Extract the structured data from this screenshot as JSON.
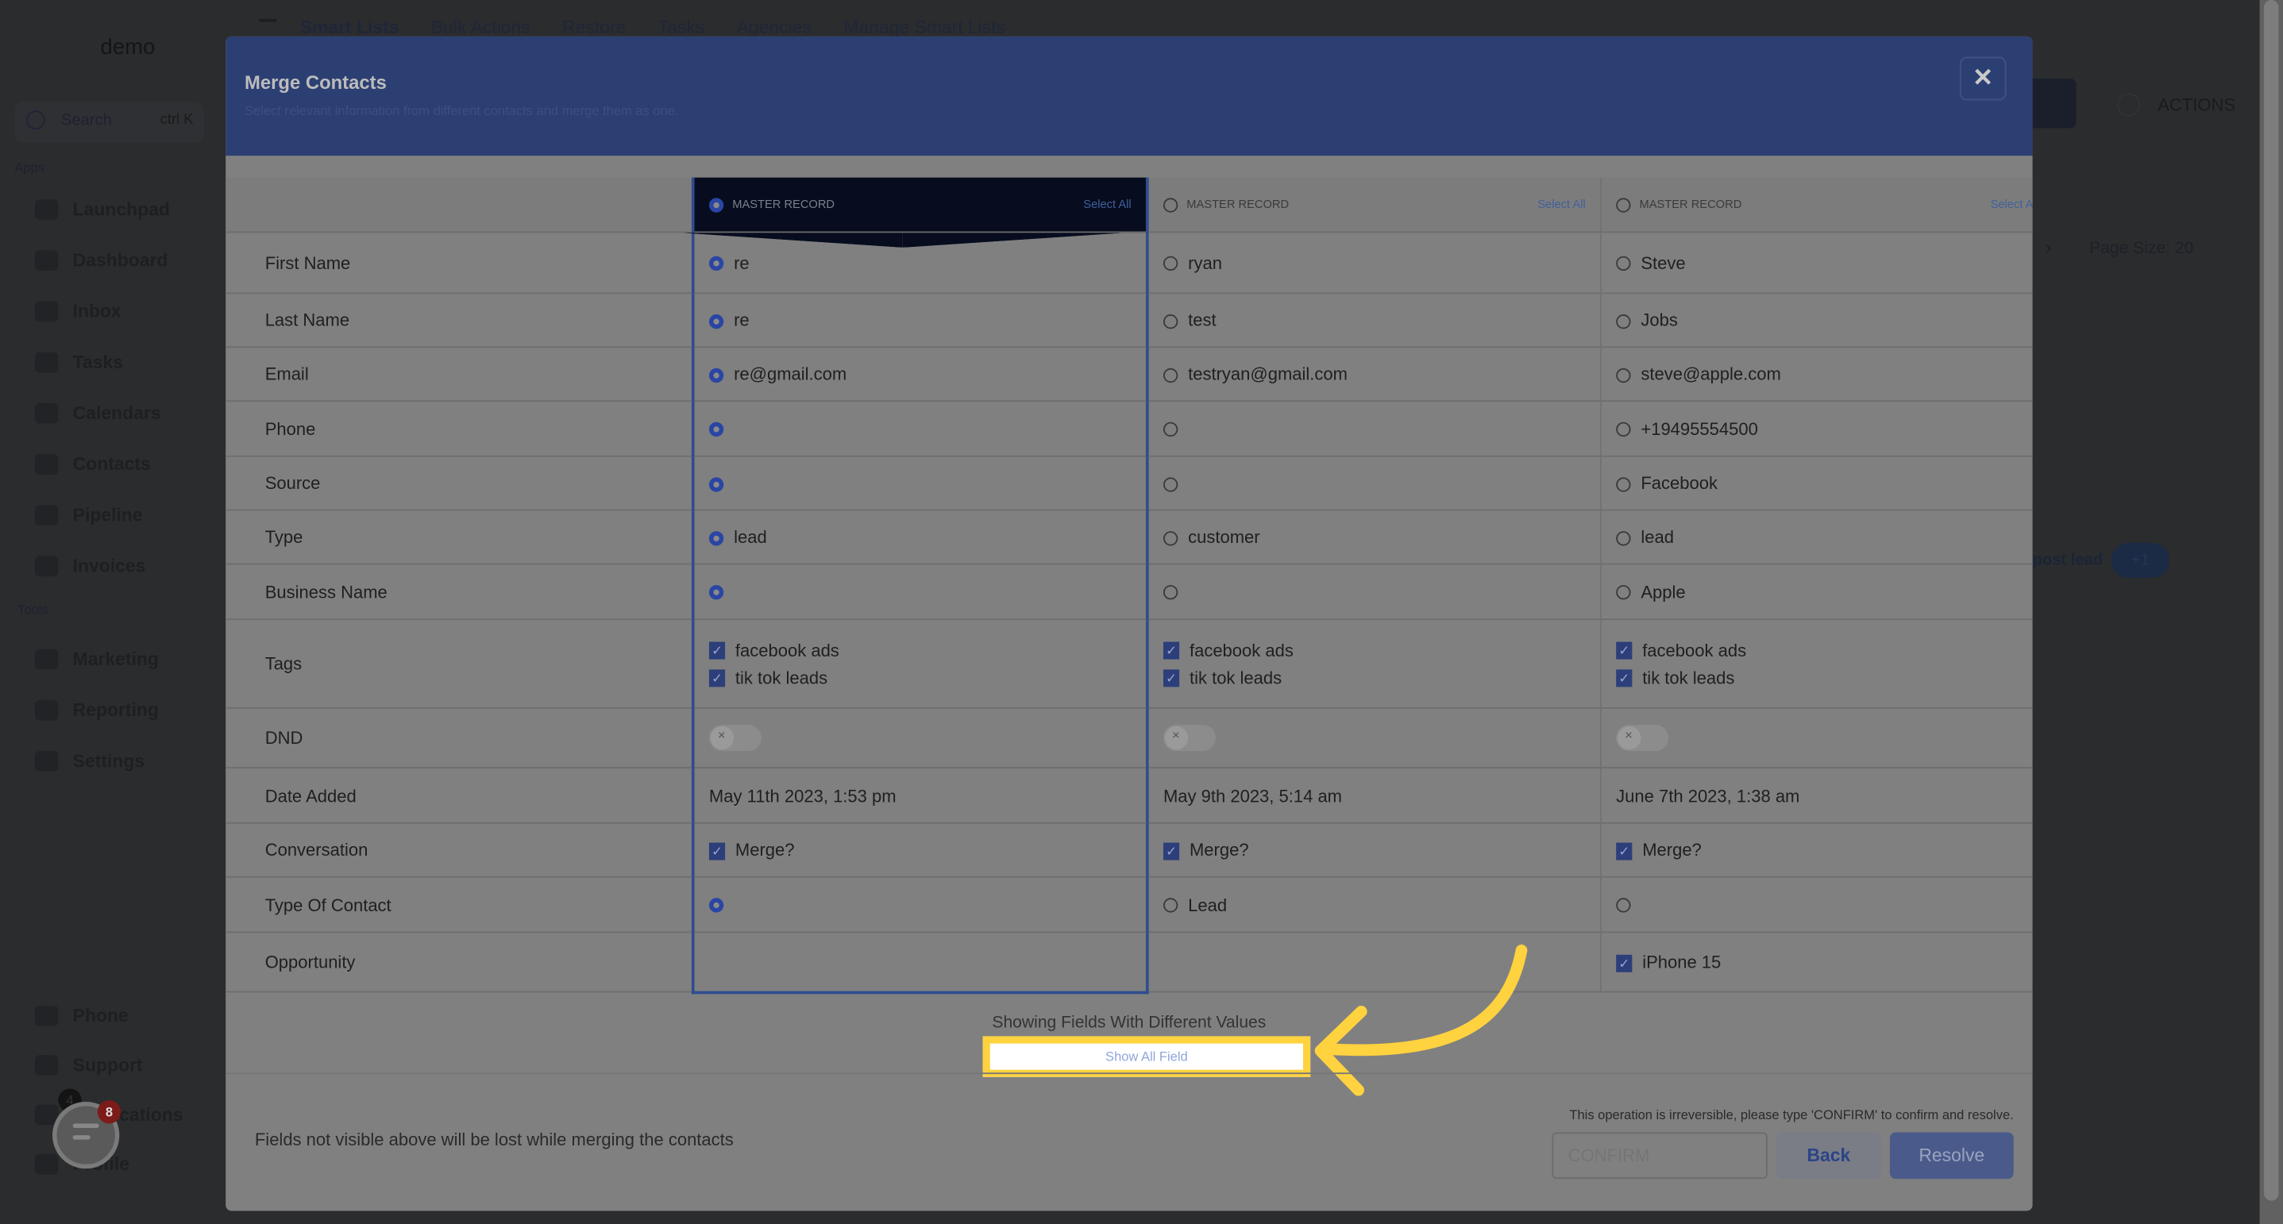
{
  "background": {
    "logo": "demo",
    "search_placeholder": "Search",
    "search_shortcut": "ctrl K",
    "apps_label": "Apps",
    "tools_label": "Tools",
    "sidebar_apps": [
      "Launchpad",
      "Dashboard",
      "Inbox",
      "Tasks",
      "Calendars",
      "Contacts",
      "Pipeline",
      "Invoices"
    ],
    "sidebar_tools": [
      "Marketing",
      "Reporting",
      "Settings"
    ],
    "sidebar_bottom": [
      "Phone",
      "Support",
      "Notifications",
      "Profile"
    ],
    "notifications_count": "4",
    "top_nav": [
      "Smart Lists",
      "Bulk Actions",
      "Restore",
      "Tasks",
      "Agencies",
      "Manage Smart Lists"
    ],
    "actions_label": "ACTIONS",
    "page_size": "Page Size: 20",
    "tag_post_lead": "post lead",
    "tag_more": "+1"
  },
  "modal": {
    "title": "Merge Contacts",
    "subtitle": "Select relevant information from different contacts and merge them as one.",
    "close_icon": "close-icon",
    "accent_color": "#2c3f73",
    "columns": [
      {
        "header": "MASTER RECORD",
        "select_all": "Select All",
        "master": true
      },
      {
        "header": "MASTER RECORD",
        "select_all": "Select All",
        "master": false
      },
      {
        "header": "MASTER RECORD",
        "select_all": "Select All",
        "master": false
      }
    ],
    "rows": [
      {
        "label": "First Name",
        "type": "radio",
        "cells": [
          {
            "value": "re",
            "selected": true
          },
          {
            "value": "ryan",
            "selected": false
          },
          {
            "value": "Steve",
            "selected": false
          }
        ]
      },
      {
        "label": "Last Name",
        "type": "radio",
        "cells": [
          {
            "value": "re",
            "selected": true
          },
          {
            "value": "test",
            "selected": false
          },
          {
            "value": "Jobs",
            "selected": false
          }
        ]
      },
      {
        "label": "Email",
        "type": "radio",
        "cells": [
          {
            "value": "re@gmail.com",
            "selected": true
          },
          {
            "value": "testryan@gmail.com",
            "selected": false
          },
          {
            "value": "steve@apple.com",
            "selected": false
          }
        ]
      },
      {
        "label": "Phone",
        "type": "radio",
        "cells": [
          {
            "value": "",
            "selected": true
          },
          {
            "value": "",
            "selected": false
          },
          {
            "value": "+19495554500",
            "selected": false
          }
        ]
      },
      {
        "label": "Source",
        "type": "radio",
        "cells": [
          {
            "value": "",
            "selected": true
          },
          {
            "value": "",
            "selected": false
          },
          {
            "value": "Facebook",
            "selected": false
          }
        ]
      },
      {
        "label": "Type",
        "type": "radio",
        "cells": [
          {
            "value": "lead",
            "selected": true
          },
          {
            "value": "customer",
            "selected": false
          },
          {
            "value": "lead",
            "selected": false
          }
        ]
      },
      {
        "label": "Business Name",
        "type": "radio",
        "cells": [
          {
            "value": "",
            "selected": true
          },
          {
            "value": "",
            "selected": false
          },
          {
            "value": "Apple",
            "selected": false
          }
        ]
      },
      {
        "label": "Tags",
        "type": "tags",
        "cells": [
          {
            "tags": [
              "facebook ads",
              "tik tok leads"
            ]
          },
          {
            "tags": [
              "facebook ads",
              "tik tok leads"
            ]
          },
          {
            "tags": [
              "facebook ads",
              "tik tok leads"
            ]
          }
        ]
      },
      {
        "label": "DND",
        "type": "toggle",
        "cells": [
          {
            "on": false
          },
          {
            "on": false
          },
          {
            "on": false
          }
        ]
      },
      {
        "label": "Date Added",
        "type": "text",
        "cells": [
          {
            "value": "May 11th 2023, 1:53 pm"
          },
          {
            "value": "May 9th 2023, 5:14 am"
          },
          {
            "value": "June 7th 2023, 1:38 am"
          }
        ]
      },
      {
        "label": "Conversation",
        "type": "checkbox",
        "cells": [
          {
            "value": "Merge?",
            "checked": true
          },
          {
            "value": "Merge?",
            "checked": true
          },
          {
            "value": "Merge?",
            "checked": true
          }
        ]
      },
      {
        "label": "Type Of Contact",
        "type": "radio",
        "cells": [
          {
            "value": "",
            "selected": true
          },
          {
            "value": "Lead",
            "selected": false
          },
          {
            "value": "",
            "selected": false
          }
        ]
      },
      {
        "label": "Opportunity",
        "type": "checkbox",
        "cells": [
          null,
          null,
          {
            "value": "iPhone 15",
            "checked": true
          }
        ]
      }
    ],
    "showing_text": "Showing Fields With Different Values",
    "show_all_label": "Show All Field",
    "footer_note": "Fields not visible above will be lost while merging the contacts",
    "irreversible_text": "This operation is irreversible, please type 'CONFIRM' to confirm and resolve.",
    "confirm_placeholder": "CONFIRM",
    "back_label": "Back",
    "resolve_label": "Resolve"
  },
  "chat_widget": {
    "badge": "8"
  },
  "annotation_color": "#ffd23f"
}
